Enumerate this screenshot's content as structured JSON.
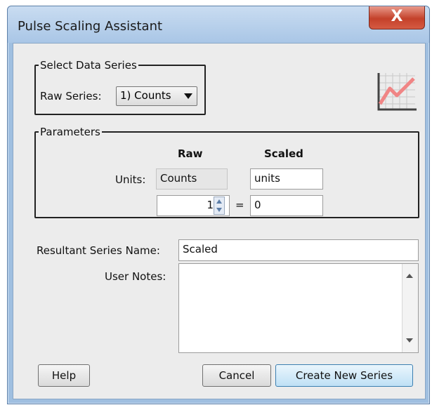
{
  "window": {
    "title": "Pulse Scaling Assistant",
    "close_label": "X"
  },
  "select_series": {
    "legend": "Select Data Series",
    "raw_series_label": "Raw Series:",
    "raw_series_value": "1) Counts"
  },
  "parameters": {
    "legend": "Parameters",
    "raw_header": "Raw",
    "scaled_header": "Scaled",
    "units_label": "Units:",
    "raw_units": "Counts",
    "scaled_units": "units",
    "raw_value": "1",
    "equals": "=",
    "scaled_value": "0"
  },
  "result": {
    "series_name_label": "Resultant Series Name:",
    "series_name_value": "Scaled"
  },
  "notes": {
    "label": "User Notes:",
    "value": ""
  },
  "buttons": {
    "help": "Help",
    "cancel": "Cancel",
    "create": "Create New Series"
  },
  "icons": {
    "close": "close-icon",
    "chart": "line-chart-icon",
    "spin": "spinner-arrows-icon",
    "dropdown": "chevron-down-icon"
  }
}
